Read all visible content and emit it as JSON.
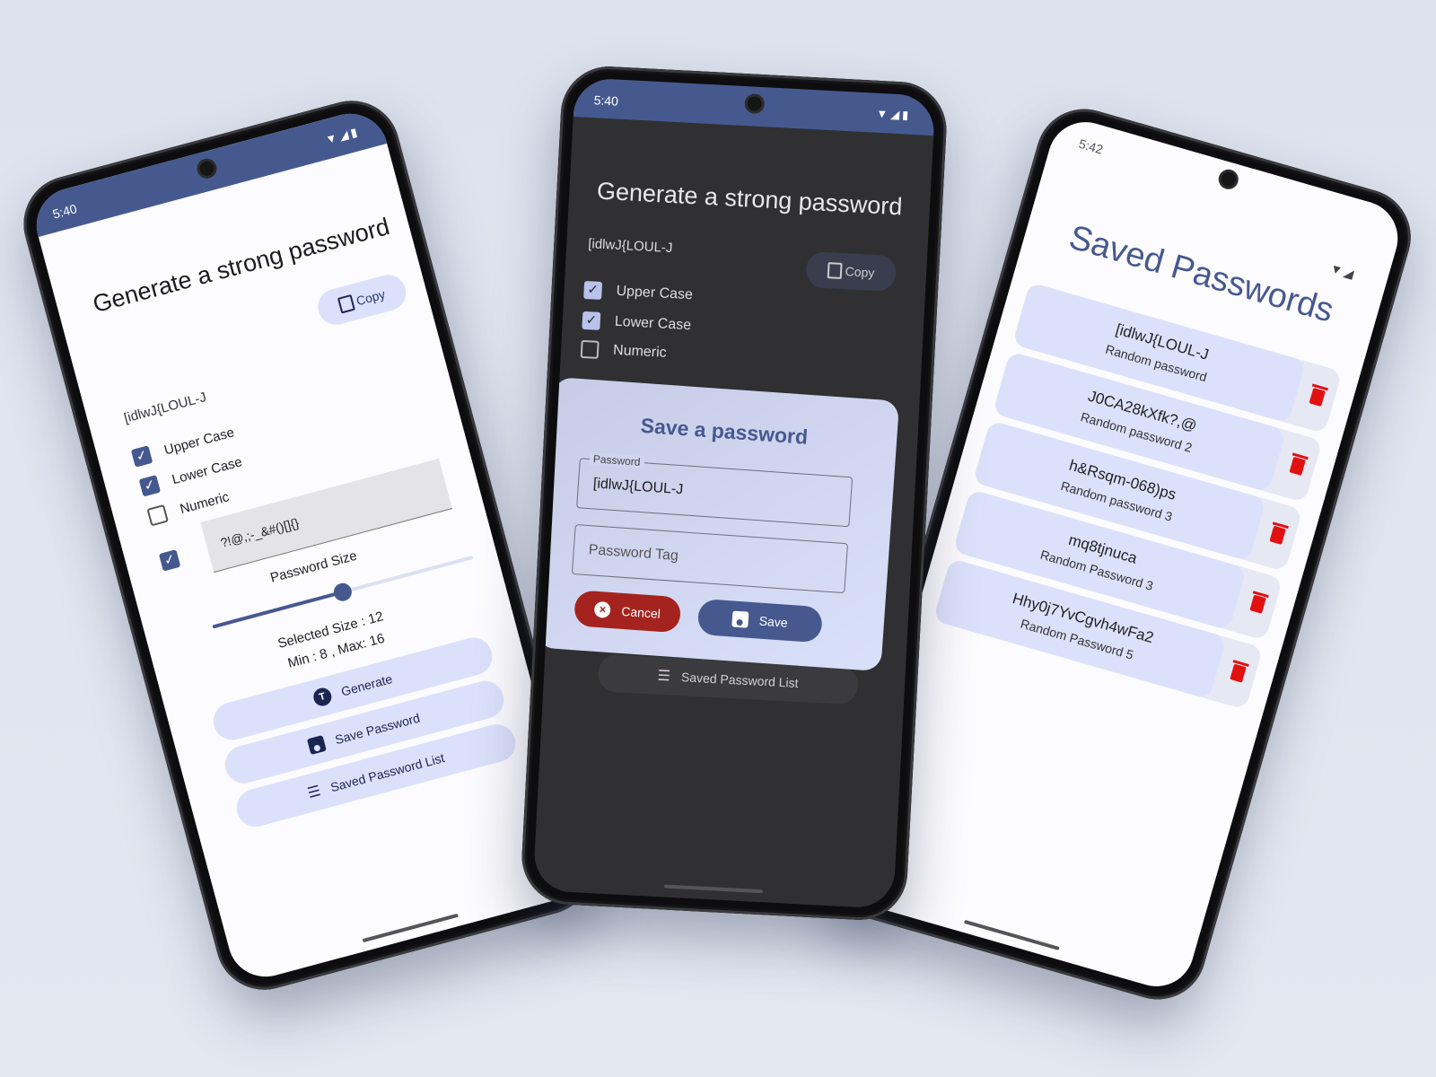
{
  "phone1": {
    "time": "5:40",
    "title": "Generate a strong password",
    "copy_label": "Copy",
    "password": "[idlwJ{LOUL-J",
    "options": [
      {
        "label": "Upper Case",
        "checked": true
      },
      {
        "label": "Lower Case",
        "checked": true
      },
      {
        "label": "Numeric",
        "checked": false
      }
    ],
    "special_chars": "?!@,;-_&#()[]{}",
    "special_checked": true,
    "size_label": "Password Size",
    "slider_value": 12,
    "slider_min": 8,
    "slider_max": 16,
    "selected_text": "Selected Size : 12",
    "minmax_text": "Min : 8 , Max: 16",
    "btn_generate": "Generate",
    "btn_save": "Save Password",
    "btn_list": "Saved Password List"
  },
  "phone2": {
    "time": "5:40",
    "title": "Generate a strong password",
    "password": "[idlwJ{LOUL-J",
    "copy_label": "Copy",
    "options": [
      {
        "label": "Upper Case",
        "checked": true
      },
      {
        "label": "Lower Case",
        "checked": true
      },
      {
        "label": "Numeric",
        "checked": false
      }
    ],
    "btn_list": "Saved Password List",
    "dialog": {
      "title": "Save a password",
      "password_label": "Password",
      "password_value": "[idlwJ{LOUL-J",
      "tag_placeholder": "Password Tag",
      "cancel": "Cancel",
      "save": "Save"
    }
  },
  "phone3": {
    "time": "5:42",
    "title": "Saved Passwords",
    "entries": [
      {
        "password": "[idlwJ{LOUL-J",
        "tag": "Random password"
      },
      {
        "password": "J0CA28kXfk?,@",
        "tag": "Random password 2"
      },
      {
        "password": "h&Rsqm-068)ps",
        "tag": "Random password 3"
      },
      {
        "password": "mq8tjnuca",
        "tag": "Random Password 3"
      },
      {
        "password": "Hhy0j7YvCgvh4wFa2",
        "tag": "Random Password 5"
      }
    ]
  },
  "colors": {
    "primary": "#46598f",
    "container": "#dce1fb",
    "danger": "#a5231e",
    "trash": "#e31010"
  }
}
